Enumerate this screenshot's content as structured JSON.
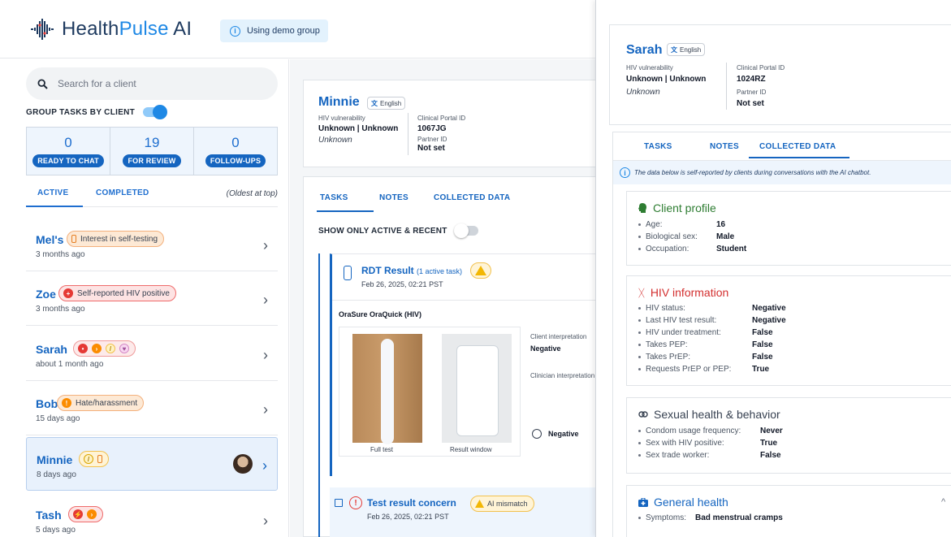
{
  "header": {
    "app_name_part1": "Health",
    "app_name_part2": "Pulse",
    "app_name_part3": " AI",
    "demo_label": "Using demo group"
  },
  "sidebar": {
    "search_placeholder": "Search for a client",
    "group_label": "GROUP TASKS BY CLIENT",
    "stats": [
      {
        "count": "0",
        "label": "READY TO CHAT"
      },
      {
        "count": "19",
        "label": "FOR REVIEW"
      },
      {
        "count": "0",
        "label": "FOLLOW-UPS"
      }
    ],
    "tabs": {
      "active": "ACTIVE",
      "completed": "COMPLETED",
      "order_note": "(Oldest at top)"
    },
    "clients": [
      {
        "name": "Mel's",
        "tag": "Interest in self-testing",
        "time": "3 months ago"
      },
      {
        "name": "Zoe",
        "tag": "Self-reported HIV positive",
        "time": "3 months ago"
      },
      {
        "name": "Sarah",
        "tag": "",
        "time": "about 1 month ago"
      },
      {
        "name": "Bob",
        "tag": "Hate/harassment",
        "time": "15 days ago"
      },
      {
        "name": "Minnie",
        "tag": "",
        "time": "8 days ago"
      },
      {
        "name": "Tash",
        "tag": "",
        "time": "5 days ago"
      }
    ]
  },
  "minnie": {
    "name": "Minnie",
    "language": "English",
    "hiv_label": "HIV vulnerability",
    "hiv_value": "Unknown | Unknown",
    "hiv_note": "Unknown",
    "portal_label": "Clinical Portal ID",
    "portal_value": "1067JG",
    "partner_label": "Partner ID",
    "partner_value": "Not set"
  },
  "tasks": {
    "tabs": [
      "TASKS",
      "NOTES",
      "COLLECTED DATA"
    ],
    "show_active_label": "SHOW ONLY ACTIVE & RECENT",
    "rdt_title": "RDT Result",
    "rdt_sub": "(1 active task)",
    "rdt_date": "Feb 26, 2025, 02:21 PST",
    "test_name": "OraSure OraQuick (HIV)",
    "caption_full": "Full test",
    "caption_window": "Result window",
    "client_interp_label": "Client interpretation",
    "client_interp_value": "Negative",
    "clinician_interp_label": "Clinician interpretation",
    "clinician_option": "Negative",
    "concern_title": "Test result concern",
    "concern_badge": "AI mismatch",
    "concern_date": "Feb 26, 2025, 02:21 PST"
  },
  "sarah": {
    "name": "Sarah",
    "language": "English",
    "hiv_label": "HIV vulnerability",
    "hiv_value": "Unknown | Unknown",
    "hiv_note": "Unknown",
    "portal_label": "Clinical Portal ID",
    "portal_value": "1024RZ",
    "partner_label": "Partner ID",
    "partner_value": "Not set"
  },
  "collected": {
    "tabs": [
      "TASKS",
      "NOTES",
      "COLLECTED DATA"
    ],
    "info": "The data below is self-reported by clients during conversations with the AI chatbot.",
    "client_profile": {
      "title": "Client profile",
      "rows": [
        {
          "label": "Age:",
          "value": "16"
        },
        {
          "label": "Biological sex:",
          "value": "Male"
        },
        {
          "label": "Occupation:",
          "value": "Student"
        }
      ]
    },
    "hiv_info": {
      "title": "HIV information",
      "rows": [
        {
          "label": "HIV status:",
          "value": "Negative"
        },
        {
          "label": "Last HIV test result:",
          "value": "Negative"
        },
        {
          "label": "HIV under treatment:",
          "value": "False"
        },
        {
          "label": "Takes PEP:",
          "value": "False"
        },
        {
          "label": "Takes PrEP:",
          "value": "False"
        },
        {
          "label": "Requests PrEP or PEP:",
          "value": "True"
        }
      ]
    },
    "sexual_health": {
      "title": "Sexual health & behavior",
      "rows": [
        {
          "label": "Condom usage frequency:",
          "value": "Never"
        },
        {
          "label": "Sex with HIV positive:",
          "value": "True"
        },
        {
          "label": "Sex trade worker:",
          "value": "False"
        }
      ]
    },
    "general_health": {
      "title": "General health",
      "rows": [
        {
          "label": "Symptoms:",
          "value": "Bad menstrual cramps"
        }
      ]
    }
  },
  "colors": {
    "primary": "#1565c0",
    "accent": "#1e88e5",
    "profile_green": "#2e7d32",
    "hiv_red": "#d32f2f",
    "gray_text": "#4b5563"
  }
}
